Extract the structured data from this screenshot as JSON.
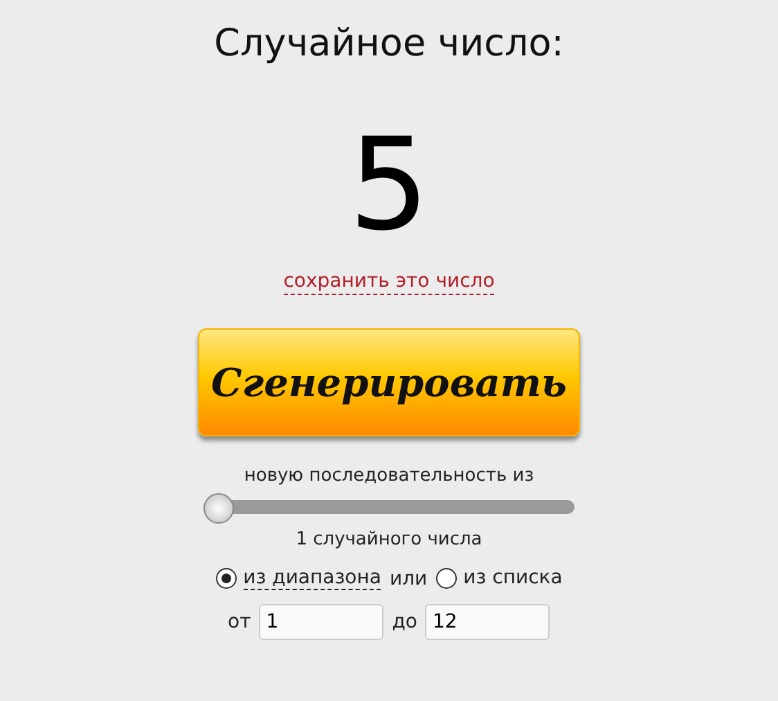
{
  "title": "Случайное число:",
  "result": "5",
  "save_link": "сохранить это число",
  "generate_button": "Сгенерировать",
  "sequence_label": "новую последовательность из",
  "count_slider": {
    "level": 0
  },
  "count_label": "1 случайного числа",
  "source_options": [
    {
      "label": "из диапазона",
      "selected": true
    },
    {
      "label": "из списка",
      "selected": false
    }
  ],
  "source_joiner": "или",
  "range": [
    {
      "label": "от",
      "value": "1"
    },
    {
      "label": "до",
      "value": "12"
    }
  ]
}
